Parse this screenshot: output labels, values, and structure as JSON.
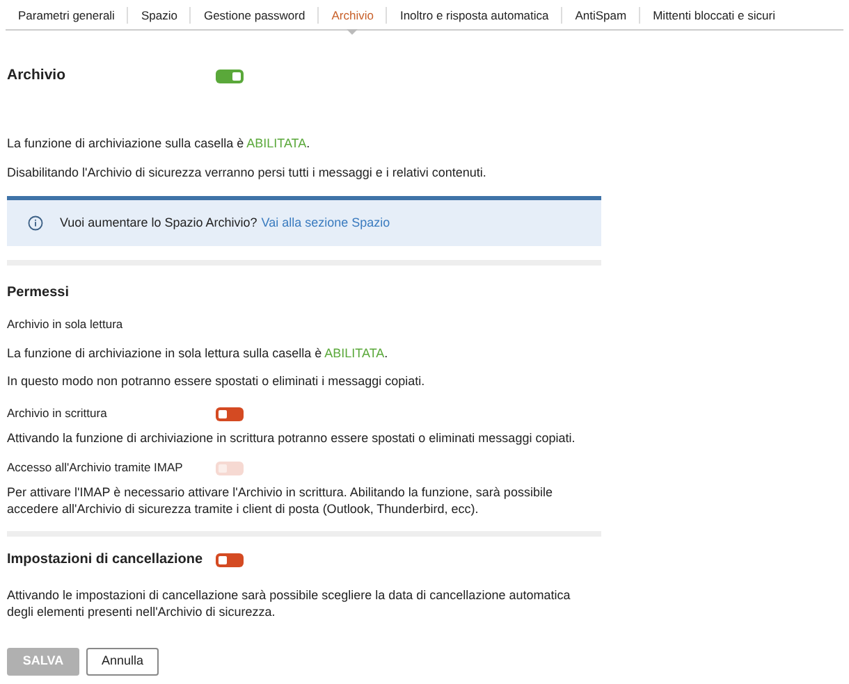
{
  "tabs": [
    {
      "label": "Parametri generali",
      "selected": false
    },
    {
      "label": "Spazio",
      "selected": false
    },
    {
      "label": "Gestione password",
      "selected": false
    },
    {
      "label": "Archivio",
      "selected": true
    },
    {
      "label": "Inoltro e risposta automatica",
      "selected": false
    },
    {
      "label": "AntiSpam",
      "selected": false
    },
    {
      "label": "Mittenti bloccati e sicuri",
      "selected": false
    }
  ],
  "archive": {
    "label": "Archivio",
    "on": true,
    "disabled": false
  },
  "status_line": {
    "text": "La funzione di archiviazione sulla casella è ",
    "status": "ABILITATA",
    "suffix": "."
  },
  "warning": "Disabilitando l'Archivio di sicurezza verranno persi tutti i messaggi e i relativi contenuti.",
  "info_banner": {
    "text": "Vuoi aumentare lo Spazio Archivio?",
    "link": "Vai alla sezione Spazio"
  },
  "permissions": {
    "title": "Permessi",
    "read_only": {
      "label": "Archivio in sola lettura",
      "status_line": {
        "text": "La funzione di archiviazione in sola lettura sulla casella è ",
        "status": "ABILITATA",
        "suffix": "."
      },
      "note": "In questo modo non potranno essere spostati o eliminati i messaggi copiati."
    },
    "settings": [
      {
        "label": "Archivio in scrittura",
        "on": false,
        "disabled": false,
        "description": "Attivando la funzione di archiviazione in scrittura potranno essere spostati o eliminati messaggi copiati."
      },
      {
        "label": "Accesso all'Archivio tramite IMAP",
        "on": false,
        "disabled": true,
        "description": "Per attivare l'IMAP è necessario attivare l'Archivio in scrittura. Abilitando la funzione, sarà possibile accedere all'Archivio di sicurezza tramite i client di posta (Outlook, Thunderbird, ecc)."
      }
    ]
  },
  "deletion": {
    "label": "Impostazioni di cancellazione",
    "on": false,
    "disabled": false,
    "description": "Attivando le impostazioni di cancellazione sarà possibile scegliere la data di cancellazione automatica degli elementi presenti nell'Archivio di sicurezza."
  },
  "buttons": [
    {
      "label": "SALVA",
      "disabled": true
    },
    {
      "label": "Annulla",
      "disabled": false
    }
  ]
}
